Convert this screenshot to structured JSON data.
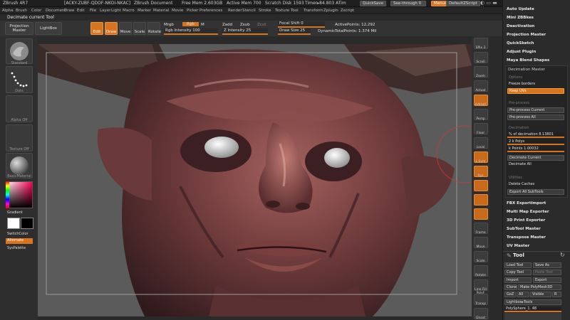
{
  "titlebar": {
    "app": "ZBrush 4R7",
    "serial": "[ACKY-ZUBF-QDOF-NKOI-NKAC]",
    "doc": "ZBrush Document",
    "mem": "Free Mem 2.603GB",
    "active_mem": "Active Mem 700",
    "scratch": "Scratch Disk 1593",
    "timer": "Timer▸84.803 ATim",
    "quicksave": "QuickSave",
    "seethrough": "See-through",
    "seethrough_val": "0",
    "menus_btn": "Menus",
    "script_btn": "DefaultZScript"
  },
  "menubar": [
    "Alpha",
    "Brush",
    "Color",
    "Document",
    "Draw",
    "Edit",
    "File",
    "Layer",
    "Light",
    "Macro",
    "Marker",
    "Material",
    "Movie",
    "Picker",
    "Preferences",
    "Render",
    "Stencil",
    "Stroke",
    "Texture",
    "Tool",
    "Transform",
    "Zplugin",
    "Zscript"
  ],
  "status": "Decimate current Tool",
  "toolbar": {
    "projection_master": "Projection Master",
    "lightbox": "LightBox",
    "edit": "Edit",
    "draw": "Draw",
    "move": "Move",
    "scale": "Scale",
    "rotate": "Rotate",
    "mrgb": "Mrgb",
    "rgb": "Rgb",
    "m": "M",
    "zadd": "Zadd",
    "zsub": "Zsub",
    "zcut": "Zcut",
    "rgb_intensity": "Rgb Intensity 100",
    "z_intensity": "Z Intensity 25",
    "focal_shift": "Focal Shift 0",
    "draw_size": "Draw Size 25",
    "dynamic": "Dynamic",
    "active_points": "ActivePoints: 12,292",
    "total_points": "TotalPoints: 1.374 Mil"
  },
  "leftshelf": {
    "standard": "Standard",
    "dots": "Dots",
    "alpha_off": "Alpha Off",
    "texture_off": "Texture Off",
    "material": "BasicMaterial",
    "gradient": "Gradient",
    "switchcolor": "SwitchColor",
    "alternate": "Alternate",
    "syspalette": "SysPalette",
    "color_main": "#ffffff",
    "color_secondary": "#000000"
  },
  "rightshelf": [
    "SPix 3",
    "Scroll",
    "Zoom",
    "Actual",
    "AAHalf",
    "Persp",
    "Floor",
    "Local",
    "L.Sym",
    "Xyz",
    "",
    "",
    "",
    "Frame",
    "Move",
    "Scale",
    "Rotate",
    "Line Fill PolyF",
    "Transp",
    "Ghost",
    "Solo",
    "Xpose"
  ],
  "palette": {
    "top_items": [
      "Auto Update",
      "Mini ZBBkes",
      "Deactivation",
      "Projection Master",
      "QuickSketch",
      "Adjust Plugin",
      "Maya Blend Shapes"
    ],
    "decimation": {
      "title": "Decimation Master",
      "options_label": "Options",
      "freeze_borders": "Freeze borders",
      "keep_uvs": "Keep UVs",
      "preprocess_label": "Pre-process",
      "preprocess_current": "Pre-process Current",
      "preprocess_all": "Pre-process All",
      "decimation_label": "Decimation",
      "pct": "% of decimation 8.13801",
      "k_polys": "k Polys",
      "k_polys_val": "2",
      "k_points": "k Points 1.00032",
      "decimate_current": "Decimate Current",
      "decimate_all": "Decimate All",
      "utilities_label": "Utilities",
      "delete_caches": "Delete Caches",
      "export_all": "Export All SubTools"
    },
    "bottom_items": [
      "FBX ExportImport",
      "Multi Map Exporter",
      "3D Print Exporter",
      "SubTool Master",
      "Transpose Master",
      "UV Master"
    ],
    "tool": {
      "title": "Tool",
      "load_tool": "Load Tool",
      "save_as": "Save As",
      "copy_tool": "Copy Tool",
      "paste_tool": "Paste Tool",
      "import": "Import",
      "export": "Export",
      "clone": "Clone",
      "make_polymesh": "Make PolyMesh3D",
      "goz": "GoZ",
      "all": "All",
      "visible": "Visible",
      "r": "R",
      "lightbox_tools": "Lightbox▸Tools",
      "polysphere": "PolySphere_1. 48"
    }
  }
}
